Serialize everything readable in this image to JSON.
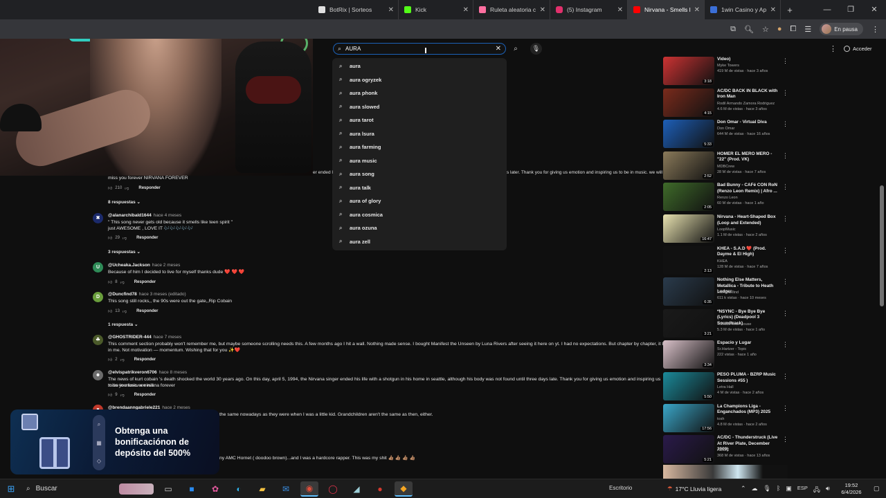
{
  "browser": {
    "tabs": [
      {
        "label": "BotRix | Sorteos",
        "favicon": "botrix-icon",
        "color": "#e0e0e0"
      },
      {
        "label": "Kick",
        "favicon": "kick-icon",
        "color": "#53fc18"
      },
      {
        "label": "Ruleta aleatoria c",
        "favicon": "ruleta-icon",
        "color": "#ff6fa0"
      },
      {
        "label": "(5) Instagram",
        "favicon": "instagram-icon",
        "color": "#e1306c"
      },
      {
        "label": "Nirvana - Smells l",
        "favicon": "youtube-icon",
        "color": "#ff0000",
        "active": true
      },
      {
        "label": "1win Casino y Ap",
        "favicon": "1win-icon",
        "color": "#3b6fd8"
      }
    ],
    "new_tab": "+",
    "profile_label": "En pausa"
  },
  "youtube": {
    "search_value": "AURA",
    "suggestions": [
      "aura",
      "aura ogryzek",
      "aura phonk",
      "aura slowed",
      "aura tarot",
      "aura lsura",
      "aura farming",
      "aura music",
      "aura song",
      "aura talk",
      "aura of glory",
      "aura cosmica",
      "aura ozuna",
      "aura zell"
    ],
    "signin_label": "Acceder"
  },
  "comments": {
    "truncated_left": "er ended l",
    "truncated_right": "s later. Thank you for giving us emotion and inspiring us to be in music. we will",
    "c0_text": "miss you forever NIRVANA FOREVER",
    "c0_likes": "210",
    "reply_label": "Responder",
    "r0_label": "8 respuestas",
    "c1_handle": "@alanarchibald1644",
    "c1_ago": "hace 4 meses",
    "c1_text_1": "\" This song never gets old  because it smells  like  teen  spirit \"",
    "c1_text_2": " just  AWESOME , LOVE  IT 🎶🎶🎶🎶🎶",
    "c1_likes": "29",
    "r1_label": "3 respuestas",
    "c2_handle": "@Ucheaka.Jackson",
    "c2_ago": "hace 2 meses",
    "c2_text": "Because of him I decided to live for myself thanks dude ❤️ ❤️ ❤️",
    "c2_likes": "8",
    "c2_avatar": "U",
    "c3_handle": "@Duncfind78",
    "c3_ago": "hace 3 meses (editado)",
    "c3_text": "This song still rocks,, the 90s were out the gate,,Rip Cobain",
    "c3_likes": "13",
    "c3_avatar": "D",
    "r3_label": "1 respuesta",
    "c4_handle": "@GHOSTRIDER-444",
    "c4_ago": "hace 7 meses",
    "c4_text_1": "This comment section probably won't remember me, but maybe someone scrolling needs this. A few months ago I hit a wall. Nothing made sense. I bought Manifest the Unseen by Luna Rivers after seeing it here on yt. I had no expectations. But chapter by chapter, it broke something open",
    "c4_text_2": "in me. Not motivation — momentum. Wishing that for you ✨❤️",
    "c4_likes": "2",
    "c5_handle": "@elvispatrikveron6706",
    "c5_ago": "hace 8 meses",
    "c5_text_1": "The news of kurt cobain 's death shocked the world 30 years ago. On this day, april 5, 1994, the Nirvana singer ended his life with a shotgun in his home in seattle, although his body was not found until three days late. Thank you for giving us emotion and inspiring us to be in music. we will",
    "c5_text_2": "miss you forever nirvana forever",
    "c5_likes": "9",
    "c6_handle": "@brendaanngabriele221",
    "c6_ago": "hace 2 meses",
    "c6_text": "the same nowadays as they were when I was a little kid.  Grandchildren aren't the same as then, either.",
    "c7_text": "ny AMC Hornet ( doodoo brown)...and I was a hardcore rapper. This was my shit 👍🏽 👍🏽 👍🏽 👍🏽"
  },
  "ad": {
    "text": "Obtenga una bonificaciónon de depósito del 500%"
  },
  "sidebar": {
    "videos": [
      {
        "title": "Video)",
        "channel": "Myke Towers",
        "views": "419 M de vistas · hace 3 años",
        "duration": "3:18",
        "color": "#c33"
      },
      {
        "title": "AC/DC BACK IN BLACK with Iron Man",
        "channel": "Rodil Armando Zamora Rodriguez",
        "views": "4.6 M de vistas · hace 3 años",
        "duration": "4:15",
        "color": "#7a2b1c"
      },
      {
        "title": "Don Omar - Virtual Diva",
        "channel": "Don Omar",
        "views": "644 M de vistas · hace 16 años",
        "duration": "5:33",
        "color": "#1d5fb8"
      },
      {
        "title": "HOMER EL MERO MERO - \"22\" (Prod. VK)",
        "channel": "MDBCrew",
        "views": "28 M de vistas · hace 7 años",
        "duration": "2:52",
        "color": "#8a7a5a"
      },
      {
        "title": "Bad Bunny - CAFé CON RoN (Renzo Leon Remix) | Afro ...",
        "channel": "Renzo Leon",
        "views": "60 M de vistas · hace 1 año",
        "duration": "2:05",
        "color": "#3f6b2a"
      },
      {
        "title": "Nirvana - Heart-Shaped Box (Loop and Extended)",
        "channel": "LoopMusic",
        "views": "1.1 M de vistas · hace 2 años",
        "duration": "16:47",
        "color": "#e8e2b0"
      },
      {
        "title": "KHEA - S.A.D ❤️ (Prod. Dayme & El High)",
        "channel": "KHEA",
        "views": "128 M de vistas · hace 7 años",
        "duration": "2:13",
        "color": "#111111"
      },
      {
        "title": "Nothing Else Matters, Metallica - Tribute to Heath Ledger",
        "channel": "DaveYaMind",
        "views": "611 k vistas · hace 10 meses",
        "duration": "6:35",
        "color": "#2a3b4c"
      },
      {
        "title": "*NSYNC - Bye Bye Bye (Lyrics) (Deadpool 3 Soundtrack)",
        "channel": "7clouds Tech House",
        "views": "5.3 M de vistas · hace 1 año",
        "duration": "3:21",
        "color": "#1a1a1a"
      },
      {
        "title": "Espacio y Lugar",
        "channel": "Sr.Hartzer - Topic",
        "views": "222 vistas · hace 1 año",
        "duration": "3:34",
        "color": "#d8c0c8"
      },
      {
        "title": "PESO PLUMA - BZRP Music Sessions #55 )",
        "channel": "Letra Hall",
        "views": "4 M de vistas · hace 2 años",
        "duration": "5:50",
        "color": "#1b8a9a"
      },
      {
        "title": "La Champions Liga - Enganchados (MP3) 2025",
        "channel": "tosh",
        "views": "4.8 M de vistas · hace 2 años",
        "duration": "17:56",
        "color": "#3aa6c8"
      },
      {
        "title": "AC/DC - Thunderstruck (Live At River Plate, December 2009)",
        "channel": "AC/DC",
        "views": "368 M de vistas · hace 13 años",
        "duration": "5:21",
        "color": "#2a1a4a"
      }
    ]
  },
  "taskbar": {
    "search_label": "Buscar",
    "weather_city": "Escritorio",
    "weather": "17°C  Lluvia ligera",
    "lang": "ESP",
    "time": "19:52",
    "date": "6/4/2026"
  }
}
